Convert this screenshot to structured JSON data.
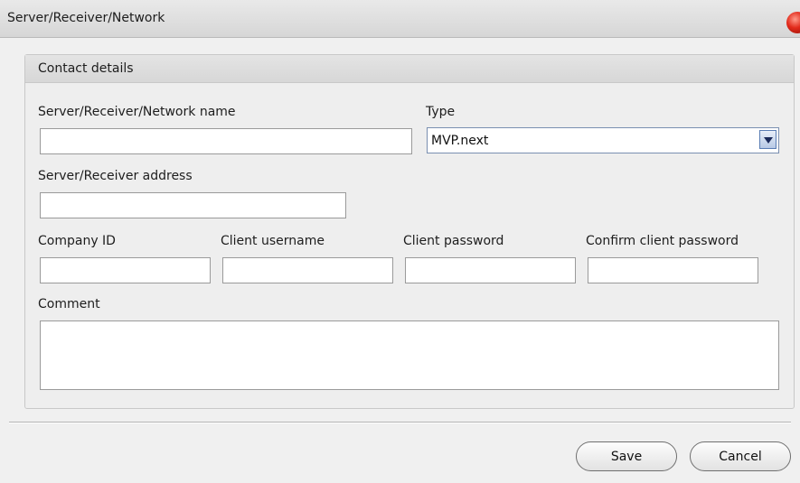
{
  "window": {
    "title": "Server/Receiver/Network"
  },
  "group": {
    "title": "Contact details"
  },
  "form": {
    "name_label": "Server/Receiver/Network name",
    "name_value": "",
    "type_label": "Type",
    "type_value": "MVP.next",
    "address_label": "Server/Receiver address",
    "address_value": "",
    "company_id_label": "Company ID",
    "company_id_value": "",
    "client_username_label": "Client username",
    "client_username_value": "",
    "client_password_label": "Client password",
    "client_password_value": "",
    "confirm_password_label": "Confirm client password",
    "confirm_password_value": "",
    "comment_label": "Comment",
    "comment_value": ""
  },
  "buttons": {
    "save_label": "Save",
    "cancel_label": "Cancel"
  },
  "icons": {
    "close": "close-icon",
    "dropdown": "chevron-down-icon"
  }
}
